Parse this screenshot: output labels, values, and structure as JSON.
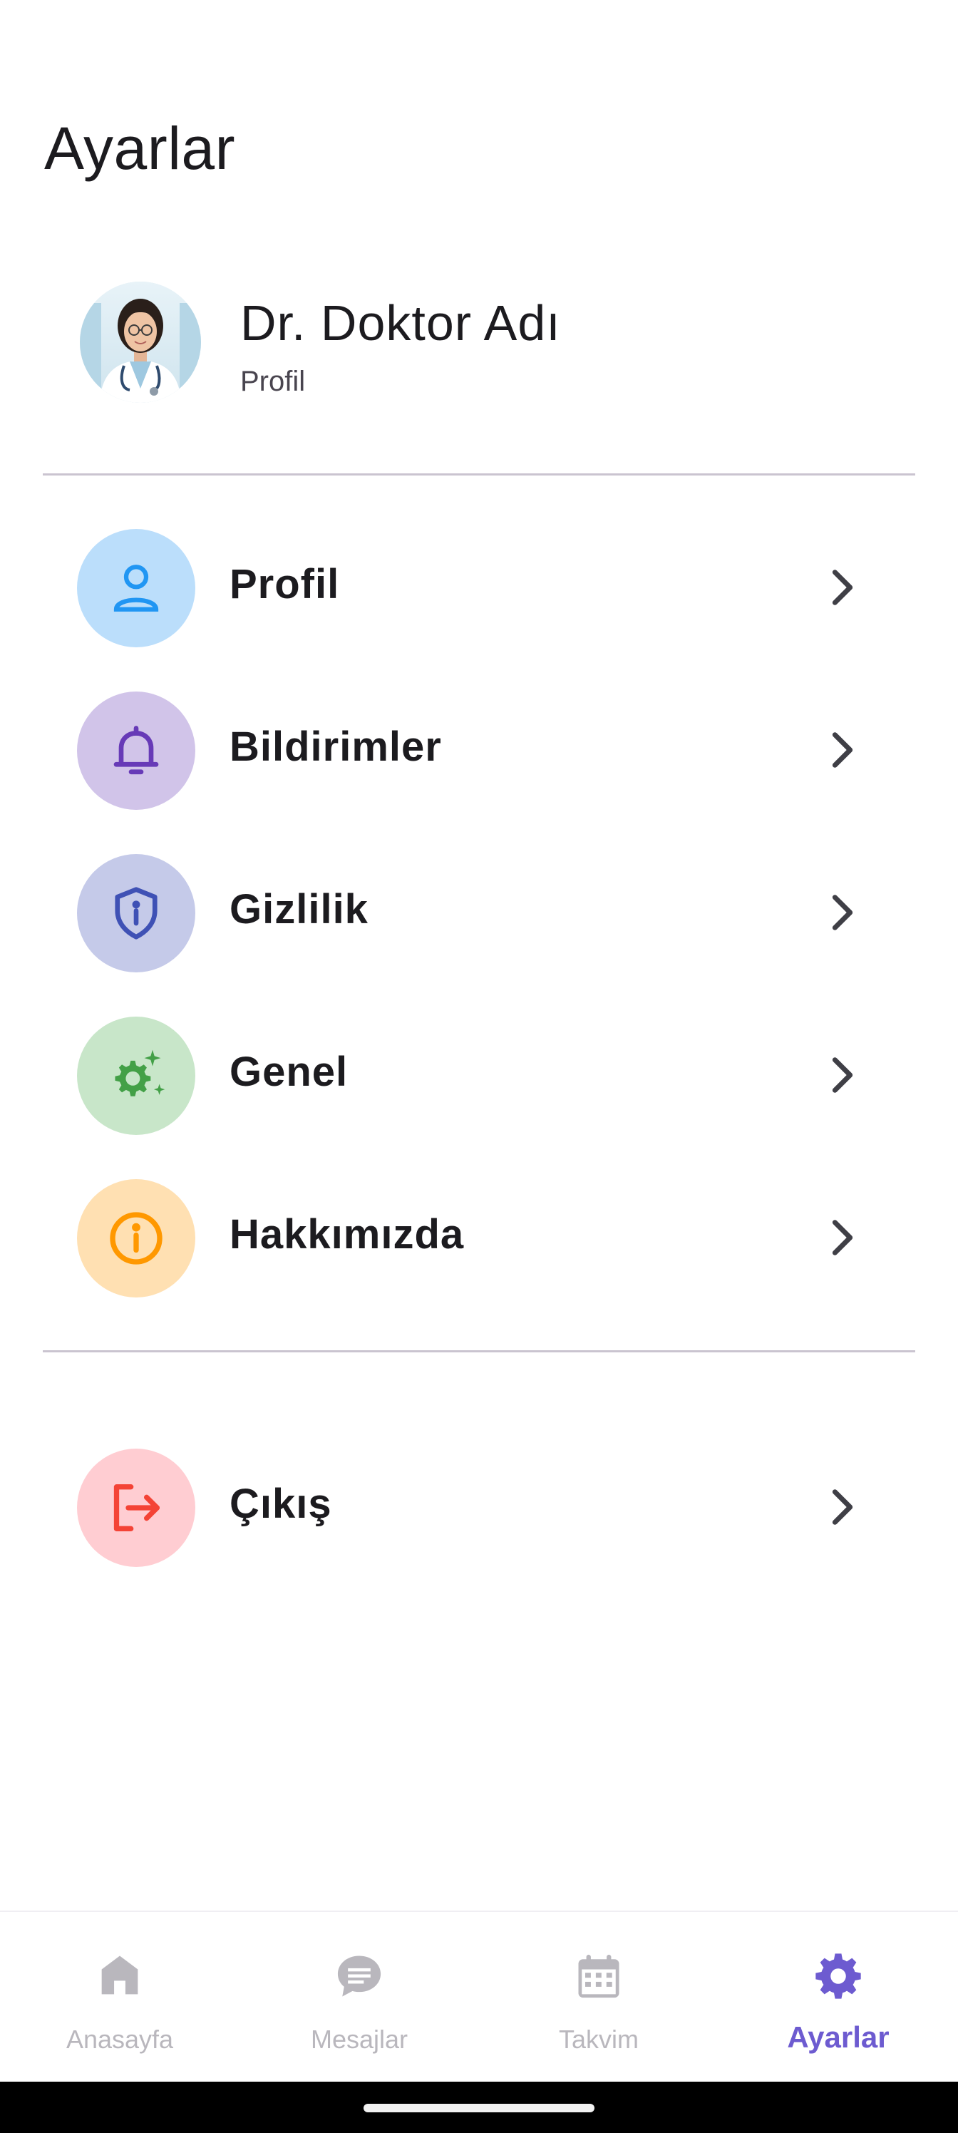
{
  "page": {
    "title": "Ayarlar"
  },
  "profile": {
    "name": "Dr. Doktor Adı",
    "subtitle": "Profil"
  },
  "menu": [
    {
      "label": "Profil",
      "icon": "person-icon",
      "color": "#2196f3",
      "bg": "#bbdefb"
    },
    {
      "label": "Bildirimler",
      "icon": "bell-icon",
      "color": "#673ab7",
      "bg": "#d1c4e9"
    },
    {
      "label": "Gizlilik",
      "icon": "shield-info-icon",
      "color": "#3f51b5",
      "bg": "#c5cae9"
    },
    {
      "label": "Genel",
      "icon": "settings-sparkle-icon",
      "color": "#43a047",
      "bg": "#c8e6c9"
    },
    {
      "label": "Hakkımızda",
      "icon": "info-icon",
      "color": "#ff9800",
      "bg": "#ffe0b2"
    }
  ],
  "logout": {
    "label": "Çıkış",
    "icon": "logout-icon",
    "color": "#f44336",
    "bg": "#ffcdd2"
  },
  "bottom_nav": [
    {
      "label": "Anasayfa",
      "icon": "home-icon",
      "active": false
    },
    {
      "label": "Mesajlar",
      "icon": "chat-icon",
      "active": false
    },
    {
      "label": "Takvim",
      "icon": "calendar-icon",
      "active": false
    },
    {
      "label": "Ayarlar",
      "icon": "gear-icon",
      "active": true
    }
  ],
  "colors": {
    "accent": "#6d5bd0",
    "inactive_nav": "#b9b7bd",
    "divider": "#cac4d0"
  }
}
